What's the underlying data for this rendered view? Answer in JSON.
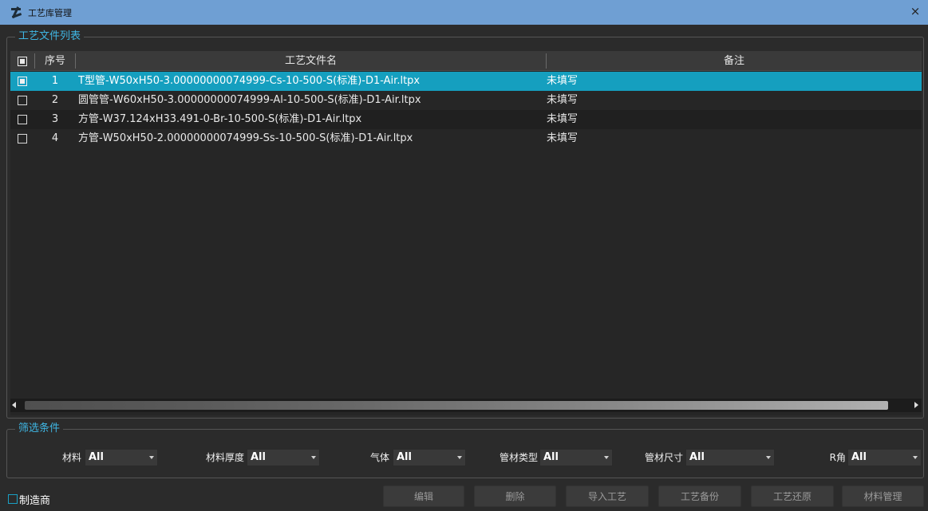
{
  "window": {
    "title": "工艺库管理",
    "close_glyph": "×",
    "icon": "app-logo-icon"
  },
  "file_list": {
    "group_title": "工艺文件列表",
    "columns": {
      "index": "序号",
      "name": "工艺文件名",
      "note": "备注"
    },
    "rows": [
      {
        "index": "1",
        "name": "T型管-W50xH50-3.00000000074999-Cs-10-500-S(标准)-D1-Air.ltpx",
        "note": "未填写",
        "selected": true
      },
      {
        "index": "2",
        "name": "圆管管-W60xH50-3.00000000074999-Al-10-500-S(标准)-D1-Air.ltpx",
        "note": "未填写",
        "selected": false
      },
      {
        "index": "3",
        "name": "方管-W37.124xH33.491-0-Br-10-500-S(标准)-D1-Air.ltpx",
        "note": "未填写",
        "selected": false
      },
      {
        "index": "4",
        "name": "方管-W50xH50-2.00000000074999-Ss-10-500-S(标准)-D1-Air.ltpx",
        "note": "未填写",
        "selected": false
      }
    ]
  },
  "filters": {
    "group_title": "筛选条件",
    "material": {
      "label": "材料",
      "value": "All"
    },
    "thickness": {
      "label": "材料厚度",
      "value": "All"
    },
    "gas": {
      "label": "气体",
      "value": "All"
    },
    "tube_type": {
      "label": "管材类型",
      "value": "All"
    },
    "tube_size": {
      "label": "管材尺寸",
      "value": "All"
    },
    "r_angle": {
      "label": "R角",
      "value": "All"
    }
  },
  "footer": {
    "manufacturer_label": "制造商",
    "buttons": {
      "edit": "编辑",
      "delete": "删除",
      "import": "导入工艺",
      "backup": "工艺备份",
      "restore": "工艺还原",
      "material": "材料管理"
    }
  },
  "colors": {
    "titlebar": "#6f9fd3",
    "selection": "#159fbf",
    "group_title": "#3fb6e3"
  }
}
